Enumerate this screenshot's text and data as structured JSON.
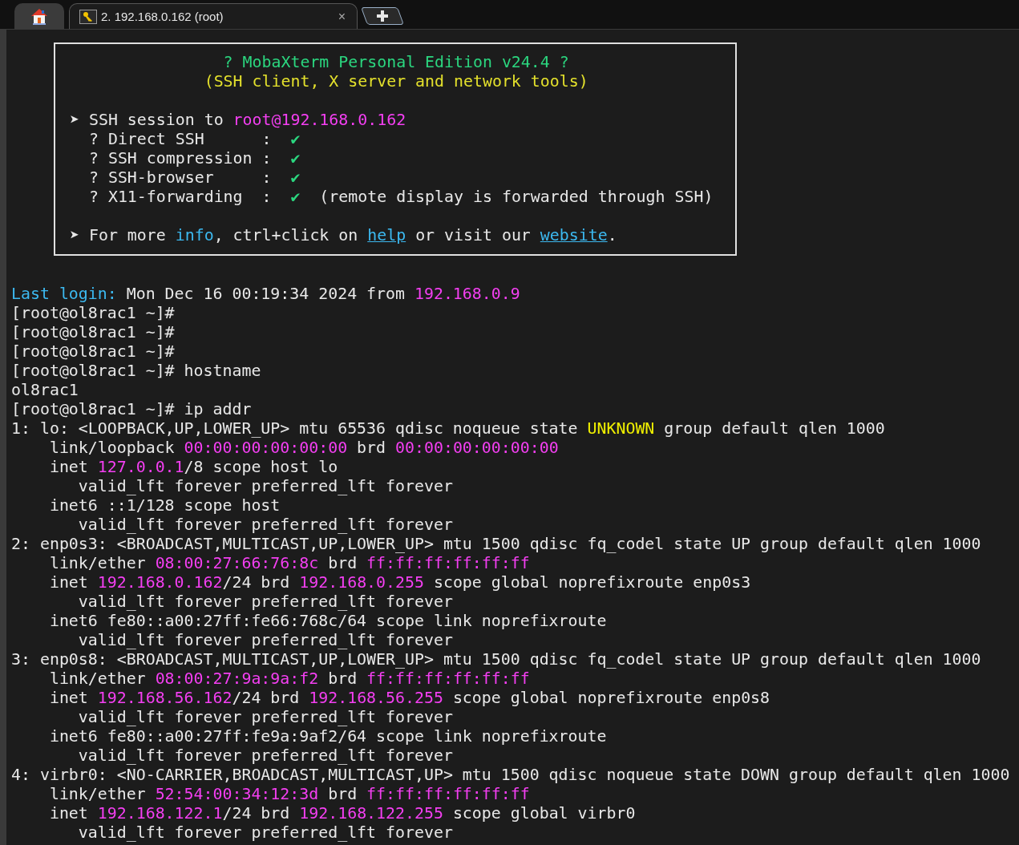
{
  "tabs": [
    {
      "kind": "home",
      "selected": false
    },
    {
      "kind": "session",
      "label": "2. 192.168.0.162 (root)",
      "close": "×",
      "selected": true
    },
    {
      "kind": "new",
      "selected": false
    }
  ],
  "banner": [
    [
      [
        {
          "text": "                ? MobaXterm Personal Edition v24.4 ?",
          "color": "#2bd67f",
          "kind": "colored"
        }
      ],
      [
        {
          "text": "              (SSH client, X server and network tools)",
          "color": "#e3e02c",
          "kind": "colored"
        }
      ]
    ],
    [
      [
        "➤ SSH session to ",
        {
          "text": "root@192.168.0.162",
          "color": "#f43ff2",
          "kind": "colored"
        }
      ],
      [
        "  ? Direct SSH      :  ",
        {
          "text": "✔",
          "color": "#2bd67f",
          "kind": "colored"
        }
      ],
      [
        "  ? SSH compression :  ",
        {
          "text": "✔",
          "color": "#2bd67f",
          "kind": "colored"
        }
      ],
      [
        "  ? SSH-browser     :  ",
        {
          "text": "✔",
          "color": "#2bd67f",
          "kind": "colored"
        }
      ],
      [
        "  ? X11-forwarding  :  ",
        {
          "text": "✔",
          "color": "#2bd67f",
          "kind": "colored"
        },
        "  (remote display is forwarded through SSH)"
      ]
    ],
    [
      [
        "➤ For more ",
        {
          "text": "info",
          "color": "#3cb9f0",
          "kind": "colored"
        },
        ", ctrl+click on ",
        {
          "text": "help",
          "color": "#3cb9f0",
          "kind": "link"
        },
        " or visit our ",
        {
          "text": "website",
          "color": "#3cb9f0",
          "kind": "link"
        },
        "."
      ]
    ]
  ],
  "terminal": [
    [
      {
        "text": "Last login:",
        "color": "#3cb9f0",
        "kind": "colored"
      },
      " Mon Dec 16 00:19:34 2024 from ",
      {
        "text": "192.168.0.9",
        "color": "#f43ff2",
        "kind": "colored"
      }
    ],
    [
      "[root@ol8rac1 ~]#"
    ],
    [
      "[root@ol8rac1 ~]#"
    ],
    [
      "[root@ol8rac1 ~]#"
    ],
    [
      "[root@ol8rac1 ~]# hostname"
    ],
    [
      "ol8rac1"
    ],
    [
      "[root@ol8rac1 ~]# ip addr"
    ],
    [
      "1: lo: <LOOPBACK,UP,LOWER_UP> mtu 65536 qdisc noqueue state ",
      {
        "text": "UNKNOWN",
        "color": "#f0f000",
        "kind": "colored"
      },
      " group default qlen 1000"
    ],
    [
      "    link/loopback ",
      {
        "text": "00:00:00:00:00:00",
        "color": "#f43ff2",
        "kind": "colored"
      },
      " brd ",
      {
        "text": "00:00:00:00:00:00",
        "color": "#f43ff2",
        "kind": "colored"
      }
    ],
    [
      "    inet ",
      {
        "text": "127.0.0.1",
        "color": "#f43ff2",
        "kind": "colored"
      },
      "/8 scope host lo"
    ],
    [
      "       valid_lft forever preferred_lft forever"
    ],
    [
      "    inet6 ::1/128 scope host"
    ],
    [
      "       valid_lft forever preferred_lft forever"
    ],
    [
      "2: enp0s3: <BROADCAST,MULTICAST,UP,LOWER_UP> mtu 1500 qdisc fq_codel state UP group default qlen 1000"
    ],
    [
      "    link/ether ",
      {
        "text": "08:00:27:66:76:8c",
        "color": "#f43ff2",
        "kind": "colored"
      },
      " brd ",
      {
        "text": "ff:ff:ff:ff:ff:ff",
        "color": "#f43ff2",
        "kind": "colored"
      }
    ],
    [
      "    inet ",
      {
        "text": "192.168.0.162",
        "color": "#f43ff2",
        "kind": "colored"
      },
      "/24 brd ",
      {
        "text": "192.168.0.255",
        "color": "#f43ff2",
        "kind": "colored"
      },
      " scope global noprefixroute enp0s3"
    ],
    [
      "       valid_lft forever preferred_lft forever"
    ],
    [
      "    inet6 fe80::a00:27ff:fe66:768c/64 scope link noprefixroute"
    ],
    [
      "       valid_lft forever preferred_lft forever"
    ],
    [
      "3: enp0s8: <BROADCAST,MULTICAST,UP,LOWER_UP> mtu 1500 qdisc fq_codel state UP group default qlen 1000"
    ],
    [
      "    link/ether ",
      {
        "text": "08:00:27:9a:9a:f2",
        "color": "#f43ff2",
        "kind": "colored"
      },
      " brd ",
      {
        "text": "ff:ff:ff:ff:ff:ff",
        "color": "#f43ff2",
        "kind": "colored"
      }
    ],
    [
      "    inet ",
      {
        "text": "192.168.56.162",
        "color": "#f43ff2",
        "kind": "colored"
      },
      "/24 brd ",
      {
        "text": "192.168.56.255",
        "color": "#f43ff2",
        "kind": "colored"
      },
      " scope global noprefixroute enp0s8"
    ],
    [
      "       valid_lft forever preferred_lft forever"
    ],
    [
      "    inet6 fe80::a00:27ff:fe9a:9af2/64 scope link noprefixroute"
    ],
    [
      "       valid_lft forever preferred_lft forever"
    ],
    [
      "4: virbr0: <NO-CARRIER,BROADCAST,MULTICAST,UP> mtu 1500 qdisc noqueue state DOWN group default qlen 1000"
    ],
    [
      "    link/ether ",
      {
        "text": "52:54:00:34:12:3d",
        "color": "#f43ff2",
        "kind": "colored"
      },
      " brd ",
      {
        "text": "ff:ff:ff:ff:ff:ff",
        "color": "#f43ff2",
        "kind": "colored"
      }
    ],
    [
      "    inet ",
      {
        "text": "192.168.122.1",
        "color": "#f43ff2",
        "kind": "colored"
      },
      "/24 brd ",
      {
        "text": "192.168.122.255",
        "color": "#f43ff2",
        "kind": "colored"
      },
      " scope global virbr0"
    ],
    [
      "       valid_lft forever preferred_lft forever"
    ]
  ]
}
